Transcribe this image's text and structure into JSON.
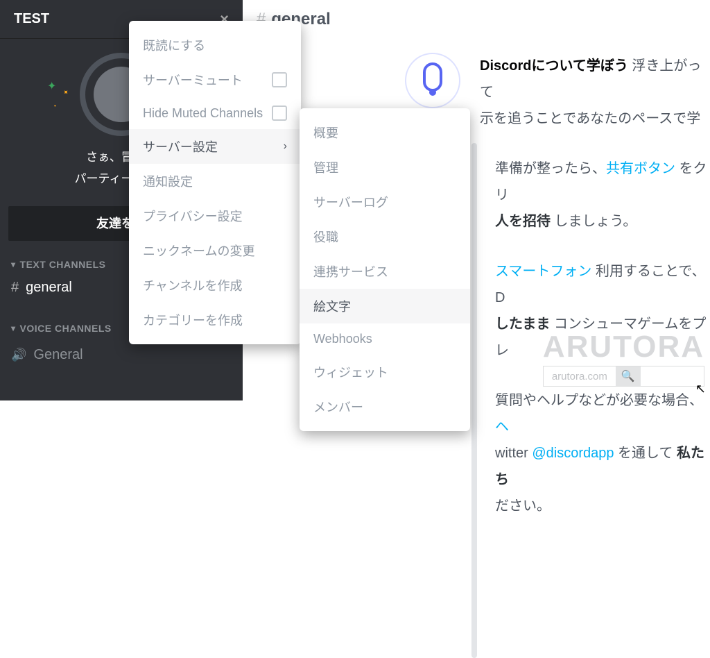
{
  "sidebar": {
    "server_name": "TEST",
    "welcome_line1": "さぁ、冒険へ",
    "welcome_line2": "パーティーに仲間",
    "invite_button": "友達を招",
    "text_channels_header": "TEXT CHANNELS",
    "voice_channels_header": "VOICE CHANNELS",
    "text_channel": "general",
    "voice_channel": "General"
  },
  "main": {
    "channel_name": "general",
    "hero_bold": "Discordについて学ぼう",
    "hero_rest": " 浮き上がって",
    "hero_line2": "示を追うことであなたのペースで学",
    "p1_a": "準備が整ったら、",
    "p1_link": "共有ボタン",
    "p1_b": " をクリ",
    "p1_c": "人を招待",
    "p1_d": " しましょう。",
    "p2_link": "スマートフォン",
    "p2_a": " 利用することで、D",
    "p2_b": "したまま",
    "p2_c": " コンシューマゲームをプレ",
    "p3_a": "質問やヘルプなどが必要な場合、",
    "p3_b": "witter ",
    "p3_mention": "@discordapp",
    "p3_c": " を通して ",
    "p3_bold": "私たち",
    "p3_d": "ださい。"
  },
  "menu1": {
    "items": [
      "既読にする",
      "サーバーミュート",
      "Hide Muted Channels",
      "サーバー設定",
      "通知設定",
      "プライバシー設定",
      "ニックネームの変更",
      "チャンネルを作成",
      "カテゴリーを作成"
    ]
  },
  "menu2": {
    "items": [
      "概要",
      "管理",
      "サーバーログ",
      "役職",
      "連携サービス",
      "絵文字",
      "Webhooks",
      "ウィジェット",
      "メンバー"
    ]
  },
  "watermark": {
    "text": "ARUTORA",
    "url": "arutora.com"
  }
}
